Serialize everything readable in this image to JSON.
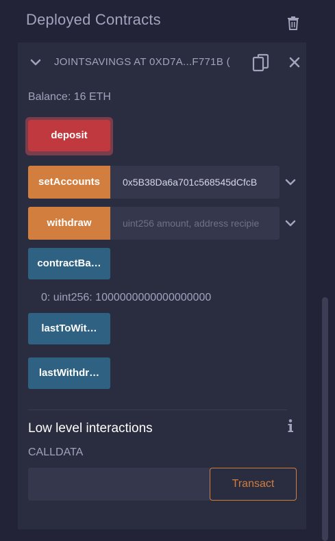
{
  "header": {
    "title": "Deployed Contracts"
  },
  "contract": {
    "name": "JOINTSAVINGS AT 0XD7A...F771B (",
    "balance": "Balance: 16 ETH",
    "functions": {
      "deposit": {
        "label": "deposit"
      },
      "setAccounts": {
        "label": "setAccounts",
        "value": "0x5B38Da6a701c568545dCfcB"
      },
      "withdraw": {
        "label": "withdraw",
        "placeholder": "uint256 amount, address recipie"
      },
      "contractBalance": {
        "label": "contractBa…",
        "result": "0: uint256: 1000000000000000000"
      },
      "lastToWithdraw": {
        "label": "lastToWit…"
      },
      "lastWithdrawAmount": {
        "label": "lastWithdr…"
      }
    }
  },
  "low_level": {
    "title": "Low level interactions",
    "calldata_label": "CALLDATA",
    "calldata_value": "",
    "transact_label": "Transact"
  },
  "colors": {
    "background": "#222336",
    "card": "#2a2c3f",
    "payable_button": "#c0393f",
    "transact_button": "#d27e3f",
    "call_button": "#2f6183"
  },
  "icons": {
    "trash": "trash-icon",
    "chevron": "chevron-down-icon",
    "copy": "copy-icon",
    "close": "close-icon",
    "info": "info-icon"
  }
}
